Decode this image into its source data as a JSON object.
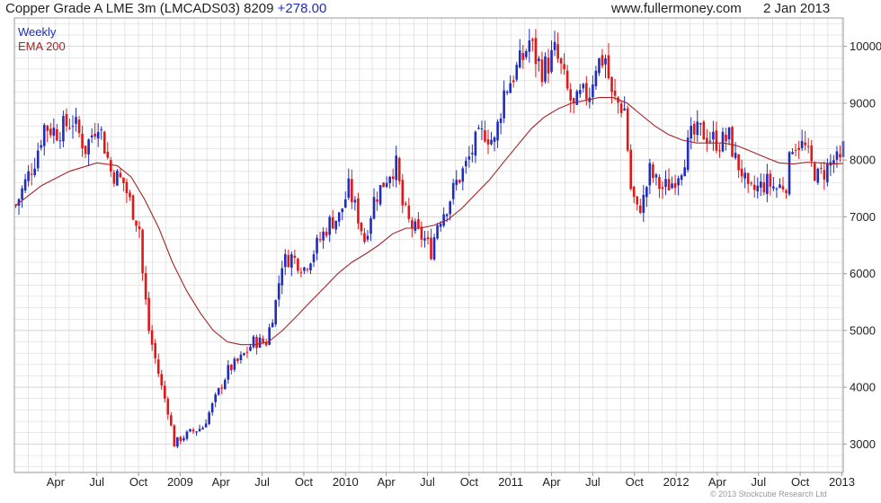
{
  "header": {
    "instrument": "Copper Grade A LME 3m (LMCADS03)",
    "last": "8209",
    "change": "+278.00",
    "website": "www.fullermoney.com",
    "date": "2 Jan 2013"
  },
  "legend": {
    "weekly": "Weekly",
    "ema": "EMA 200"
  },
  "credit": "© 2013 Stockcube Research Ltd",
  "colors": {
    "up": "#1f2dbf",
    "down": "#e01818",
    "ema": "#a42424",
    "grid": "#d4d4d4",
    "axis": "#9a9a9a"
  },
  "chart_data": {
    "type": "candlestick",
    "title": "Copper Grade A LME 3m (LMCADS03)",
    "frequency": "Weekly",
    "x_range": [
      "2008-01-01",
      "2013-01-04"
    ],
    "ylim": [
      2500,
      10500
    ],
    "y_ticks": [
      3000,
      4000,
      5000,
      6000,
      7000,
      8000,
      9000,
      10000
    ],
    "x_ticks": [
      {
        "label": "Apr",
        "date": "2008-04-01"
      },
      {
        "label": "Jul",
        "date": "2008-07-01"
      },
      {
        "label": "Oct",
        "date": "2008-10-01"
      },
      {
        "label": "2009",
        "date": "2009-01-01"
      },
      {
        "label": "Apr",
        "date": "2009-04-01"
      },
      {
        "label": "Jul",
        "date": "2009-07-01"
      },
      {
        "label": "Oct",
        "date": "2009-10-01"
      },
      {
        "label": "2010",
        "date": "2010-01-01"
      },
      {
        "label": "Apr",
        "date": "2010-04-01"
      },
      {
        "label": "Jul",
        "date": "2010-07-01"
      },
      {
        "label": "Oct",
        "date": "2010-10-01"
      },
      {
        "label": "2011",
        "date": "2011-01-01"
      },
      {
        "label": "Apr",
        "date": "2011-04-01"
      },
      {
        "label": "Jul",
        "date": "2011-07-01"
      },
      {
        "label": "Oct",
        "date": "2011-10-01"
      },
      {
        "label": "2012",
        "date": "2012-01-01"
      },
      {
        "label": "Apr",
        "date": "2012-04-01"
      },
      {
        "label": "Jul",
        "date": "2012-07-01"
      },
      {
        "label": "Oct",
        "date": "2012-10-01"
      },
      {
        "label": "2013",
        "date": "2013-01-01"
      }
    ],
    "price_path": [
      [
        "2008-01-04",
        7200
      ],
      [
        "2008-02-15",
        8000
      ],
      [
        "2008-03-07",
        8600
      ],
      [
        "2008-04-04",
        8500
      ],
      [
        "2008-05-09",
        8700
      ],
      [
        "2008-06-06",
        8200
      ],
      [
        "2008-07-04",
        8700
      ],
      [
        "2008-08-01",
        7800
      ],
      [
        "2008-08-29",
        7600
      ],
      [
        "2008-09-19",
        7100
      ],
      [
        "2008-10-03",
        6800
      ],
      [
        "2008-10-10",
        6000
      ],
      [
        "2008-10-24",
        5000
      ],
      [
        "2008-11-07",
        4500
      ],
      [
        "2008-11-21",
        4000
      ],
      [
        "2008-12-05",
        3600
      ],
      [
        "2008-12-19",
        3000
      ],
      [
        "2009-01-02",
        3100
      ],
      [
        "2009-01-23",
        3200
      ],
      [
        "2009-02-20",
        3300
      ],
      [
        "2009-03-20",
        3800
      ],
      [
        "2009-04-17",
        4300
      ],
      [
        "2009-05-15",
        4500
      ],
      [
        "2009-06-12",
        4800
      ],
      [
        "2009-07-10",
        4800
      ],
      [
        "2009-07-31",
        5500
      ],
      [
        "2009-08-14",
        6200
      ],
      [
        "2009-09-04",
        6300
      ],
      [
        "2009-10-02",
        6100
      ],
      [
        "2009-10-16",
        6300
      ],
      [
        "2009-11-06",
        6600
      ],
      [
        "2009-11-27",
        6900
      ],
      [
        "2009-12-18",
        7000
      ],
      [
        "2010-01-08",
        7500
      ],
      [
        "2010-01-29",
        7000
      ],
      [
        "2010-02-12",
        6600
      ],
      [
        "2010-03-05",
        7300
      ],
      [
        "2010-03-26",
        7600
      ],
      [
        "2010-04-09",
        7800
      ],
      [
        "2010-04-23",
        7900
      ],
      [
        "2010-05-07",
        7200
      ],
      [
        "2010-05-21",
        6900
      ],
      [
        "2010-06-11",
        6700
      ],
      [
        "2010-06-25",
        6600
      ],
      [
        "2010-07-09",
        6400
      ],
      [
        "2010-07-23",
        6900
      ],
      [
        "2010-08-13",
        7200
      ],
      [
        "2010-09-03",
        7600
      ],
      [
        "2010-09-24",
        7900
      ],
      [
        "2010-10-15",
        8300
      ],
      [
        "2010-11-05",
        8500
      ],
      [
        "2010-11-26",
        8300
      ],
      [
        "2010-12-17",
        9200
      ],
      [
        "2011-01-07",
        9500
      ],
      [
        "2011-01-28",
        9800
      ],
      [
        "2011-02-11",
        10100
      ],
      [
        "2011-02-25",
        9800
      ],
      [
        "2011-03-11",
        9600
      ],
      [
        "2011-03-25",
        9700
      ],
      [
        "2011-04-08",
        9900
      ],
      [
        "2011-04-22",
        9600
      ],
      [
        "2011-05-06",
        9200
      ],
      [
        "2011-05-20",
        8900
      ],
      [
        "2011-06-03",
        9100
      ],
      [
        "2011-06-24",
        9200
      ],
      [
        "2011-07-08",
        9700
      ],
      [
        "2011-07-29",
        9800
      ],
      [
        "2011-08-12",
        9100
      ],
      [
        "2011-08-26",
        9000
      ],
      [
        "2011-09-09",
        8900
      ],
      [
        "2011-09-23",
        7500
      ],
      [
        "2011-10-07",
        7100
      ],
      [
        "2011-10-21",
        7300
      ],
      [
        "2011-11-04",
        7800
      ],
      [
        "2011-11-18",
        7600
      ],
      [
        "2011-12-02",
        7500
      ],
      [
        "2011-12-23",
        7600
      ],
      [
        "2012-01-13",
        7900
      ],
      [
        "2012-02-03",
        8400
      ],
      [
        "2012-02-24",
        8500
      ],
      [
        "2012-03-16",
        8400
      ],
      [
        "2012-04-06",
        8300
      ],
      [
        "2012-04-27",
        8400
      ],
      [
        "2012-05-11",
        8000
      ],
      [
        "2012-05-25",
        7800
      ],
      [
        "2012-06-08",
        7400
      ],
      [
        "2012-06-29",
        7500
      ],
      [
        "2012-07-20",
        7600
      ],
      [
        "2012-08-10",
        7500
      ],
      [
        "2012-08-31",
        7600
      ],
      [
        "2012-09-14",
        8300
      ],
      [
        "2012-09-28",
        8300
      ],
      [
        "2012-10-12",
        8200
      ],
      [
        "2012-10-26",
        7900
      ],
      [
        "2012-11-09",
        7700
      ],
      [
        "2012-11-23",
        7800
      ],
      [
        "2012-12-14",
        8000
      ],
      [
        "2012-12-28",
        7930
      ],
      [
        "2013-01-04",
        8209
      ]
    ],
    "ema": {
      "name": "EMA 200",
      "points": [
        [
          "2008-01-04",
          7200
        ],
        [
          "2008-03-01",
          7550
        ],
        [
          "2008-05-01",
          7800
        ],
        [
          "2008-07-01",
          7950
        ],
        [
          "2008-08-15",
          7900
        ],
        [
          "2008-09-15",
          7700
        ],
        [
          "2008-10-15",
          7300
        ],
        [
          "2008-11-15",
          6800
        ],
        [
          "2008-12-15",
          6200
        ],
        [
          "2009-01-15",
          5700
        ],
        [
          "2009-02-15",
          5300
        ],
        [
          "2009-03-15",
          5000
        ],
        [
          "2009-04-15",
          4800
        ],
        [
          "2009-05-15",
          4750
        ],
        [
          "2009-06-15",
          4750
        ],
        [
          "2009-07-15",
          4800
        ],
        [
          "2009-08-15",
          5000
        ],
        [
          "2009-09-15",
          5250
        ],
        [
          "2009-10-15",
          5500
        ],
        [
          "2009-11-15",
          5750
        ],
        [
          "2009-12-15",
          6000
        ],
        [
          "2010-01-15",
          6200
        ],
        [
          "2010-02-15",
          6350
        ],
        [
          "2010-03-15",
          6500
        ],
        [
          "2010-04-15",
          6700
        ],
        [
          "2010-05-15",
          6800
        ],
        [
          "2010-06-15",
          6800
        ],
        [
          "2010-07-15",
          6850
        ],
        [
          "2010-08-15",
          6950
        ],
        [
          "2010-09-15",
          7150
        ],
        [
          "2010-10-15",
          7400
        ],
        [
          "2010-11-15",
          7650
        ],
        [
          "2010-12-15",
          7950
        ],
        [
          "2011-01-15",
          8250
        ],
        [
          "2011-02-15",
          8550
        ],
        [
          "2011-03-15",
          8750
        ],
        [
          "2011-04-15",
          8900
        ],
        [
          "2011-05-15",
          9000
        ],
        [
          "2011-06-15",
          9050
        ],
        [
          "2011-07-15",
          9100
        ],
        [
          "2011-08-15",
          9100
        ],
        [
          "2011-09-15",
          9000
        ],
        [
          "2011-10-15",
          8800
        ],
        [
          "2011-11-15",
          8600
        ],
        [
          "2011-12-15",
          8450
        ],
        [
          "2012-01-15",
          8350
        ],
        [
          "2012-02-15",
          8300
        ],
        [
          "2012-03-15",
          8300
        ],
        [
          "2012-04-15",
          8300
        ],
        [
          "2012-05-15",
          8250
        ],
        [
          "2012-06-15",
          8150
        ],
        [
          "2012-07-15",
          8050
        ],
        [
          "2012-08-15",
          7950
        ],
        [
          "2012-09-15",
          7930
        ],
        [
          "2012-10-15",
          7960
        ],
        [
          "2012-11-15",
          7950
        ],
        [
          "2012-12-15",
          7930
        ],
        [
          "2013-01-04",
          7940
        ]
      ]
    }
  }
}
